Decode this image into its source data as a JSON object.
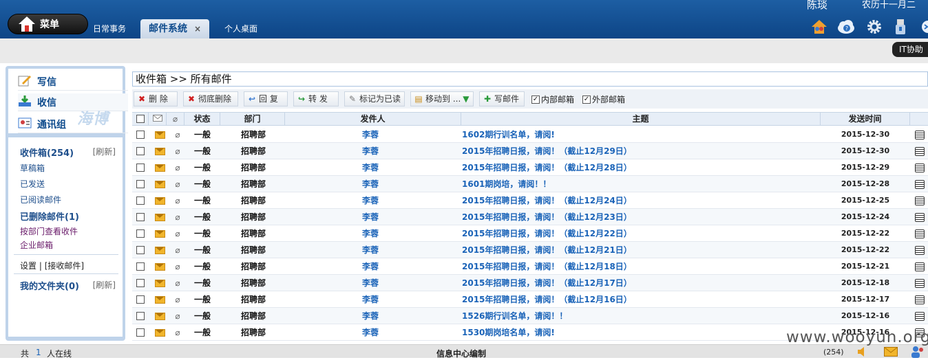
{
  "header": {
    "menu_label": "菜单",
    "tabs": [
      {
        "label": "日常事务"
      },
      {
        "label": "邮件系统",
        "close": "×"
      },
      {
        "label": "个人桌面"
      }
    ],
    "user": "陈琰",
    "lunar_date": "农历十一月二",
    "icons": [
      "home-people-icon",
      "cloud-help-icon",
      "gear-icon",
      "usb-icon",
      "more-icon"
    ],
    "it_help": "IT协助"
  },
  "left": {
    "actions": [
      {
        "label": "写信",
        "icon": "compose-icon"
      },
      {
        "label": "收信",
        "icon": "inbox-icon"
      },
      {
        "label": "通讯组",
        "icon": "contacts-icon"
      }
    ],
    "logo_text": "海博",
    "inbox": "收件箱(254)",
    "refresh": "[刷新]",
    "folders": [
      "草稿箱",
      "已发送",
      "已阅读邮件",
      "已删除邮件(1)",
      "按部门查看收件",
      "企业邮箱"
    ],
    "settings": "设置",
    "receive": "[接收邮件]",
    "my_folders": "我的文件夹(0)",
    "refresh2": "[刷新]"
  },
  "main": {
    "breadcrumb": "收件箱 >> 所有邮件",
    "toolbar": {
      "delete": "删 除",
      "purge": "彻底删除",
      "reply": "回 复",
      "forward": "转 发",
      "mark_read": "标记为已读",
      "move": "移动到 ...",
      "compose": "写邮件",
      "internal": "内部邮箱",
      "external": "外部邮箱"
    },
    "columns": {
      "status": "状态",
      "dept": "部门",
      "sender": "发件人",
      "subject": "主题",
      "date": "发送时间"
    },
    "rows": [
      {
        "status": "一般",
        "dept": "招聘部",
        "sender": "李蓉",
        "subject": "1602期行训名单，请阅!",
        "date": "2015-12-30"
      },
      {
        "status": "一般",
        "dept": "招聘部",
        "sender": "李蓉",
        "subject": "2015年招聘日报，请阅！（截止12月29日）",
        "date": "2015-12-30"
      },
      {
        "status": "一般",
        "dept": "招聘部",
        "sender": "李蓉",
        "subject": "2015年招聘日报，请阅！（截止12月28日）",
        "date": "2015-12-29"
      },
      {
        "status": "一般",
        "dept": "招聘部",
        "sender": "李蓉",
        "subject": "1601期岗培，请阅！！",
        "date": "2015-12-28"
      },
      {
        "status": "一般",
        "dept": "招聘部",
        "sender": "李蓉",
        "subject": "2015年招聘日报，请阅！（截止12月24日）",
        "date": "2015-12-25"
      },
      {
        "status": "一般",
        "dept": "招聘部",
        "sender": "李蓉",
        "subject": "2015年招聘日报，请阅！（截止12月23日）",
        "date": "2015-12-24"
      },
      {
        "status": "一般",
        "dept": "招聘部",
        "sender": "李蓉",
        "subject": "2015年招聘日报，请阅！（截止12月22日）",
        "date": "2015-12-22"
      },
      {
        "status": "一般",
        "dept": "招聘部",
        "sender": "李蓉",
        "subject": "2015年招聘日报，请阅！（截止12月21日）",
        "date": "2015-12-22"
      },
      {
        "status": "一般",
        "dept": "招聘部",
        "sender": "李蓉",
        "subject": "2015年招聘日报，请阅！（截止12月18日）",
        "date": "2015-12-21"
      },
      {
        "status": "一般",
        "dept": "招聘部",
        "sender": "李蓉",
        "subject": "2015年招聘日报，请阅！（截止12月17日）",
        "date": "2015-12-18"
      },
      {
        "status": "一般",
        "dept": "招聘部",
        "sender": "李蓉",
        "subject": "2015年招聘日报，请阅！（截止12月16日）",
        "date": "2015-12-17"
      },
      {
        "status": "一般",
        "dept": "招聘部",
        "sender": "李蓉",
        "subject": "1526期行训名单，请阅！！",
        "date": "2015-12-16"
      },
      {
        "status": "一般",
        "dept": "招聘部",
        "sender": "李蓉",
        "subject": "1530期岗培名单，请阅!",
        "date": "2015-12-16"
      }
    ]
  },
  "footer": {
    "online_prefix": "共",
    "online_count": "1",
    "online_suffix": "人在线",
    "center": "信息中心编制",
    "mail_count": "(254)"
  },
  "watermark": "www.wooyun.org"
}
